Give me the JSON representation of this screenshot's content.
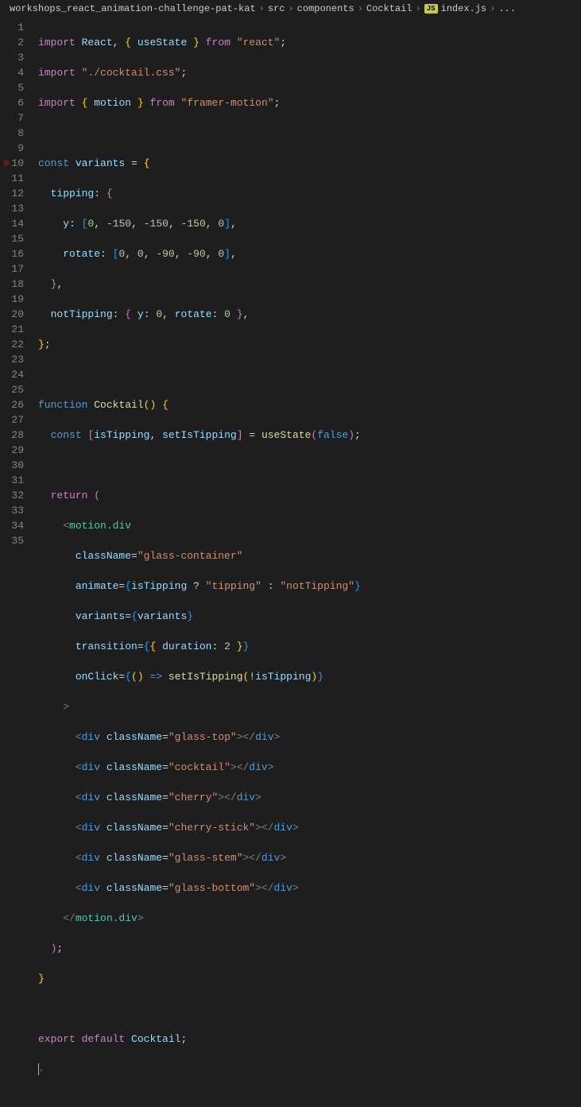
{
  "breadcrumb": {
    "items": [
      "workshops_react_animation-challenge-pat-kat",
      "src",
      "components",
      "Cocktail"
    ],
    "file": "index.js",
    "tail": "..."
  },
  "gutter": {
    "start": 1,
    "end": 35,
    "breakpoint": 10
  },
  "code": {
    "l1": {
      "t1": "import",
      "t2": "React",
      "t3": "useState",
      "t4": "from",
      "t5": "\"react\""
    },
    "l2": {
      "t1": "import",
      "t2": "\"./cocktail.css\""
    },
    "l3": {
      "t1": "import",
      "t2": "motion",
      "t3": "from",
      "t4": "\"framer-motion\""
    },
    "l5": {
      "t1": "const",
      "t2": "variants",
      "t3": "="
    },
    "l6": {
      "t1": "tipping",
      "t2": ":"
    },
    "l7": {
      "t1": "y",
      "t2": ":",
      "a": "0",
      "b": "-150",
      "c": "-150",
      "d": "-150",
      "e": "0"
    },
    "l8": {
      "t1": "rotate",
      "t2": ":",
      "a": "0",
      "b": "0",
      "c": "-90",
      "d": "-90",
      "e": "0"
    },
    "l10": {
      "t1": "notTipping",
      "t2": ":",
      "y": "y",
      "yv": "0",
      "r": "rotate",
      "rv": "0"
    },
    "l13": {
      "t1": "function",
      "t2": "Cocktail"
    },
    "l14": {
      "t1": "const",
      "a": "isTipping",
      "b": "setIsTipping",
      "c": "=",
      "d": "useState",
      "e": "false"
    },
    "l16": {
      "t1": "return"
    },
    "l17": {
      "t1": "motion.div"
    },
    "l18": {
      "a": "className",
      "b": "=",
      "c": "\"glass-container\""
    },
    "l19": {
      "a": "animate",
      "b": "=",
      "c": "isTipping",
      "d": "?",
      "e": "\"tipping\"",
      "f": ":",
      "g": "\"notTipping\""
    },
    "l20": {
      "a": "variants",
      "b": "=",
      "c": "variants"
    },
    "l21": {
      "a": "transition",
      "b": "=",
      "c": "duration",
      "d": ":",
      "e": "2"
    },
    "l22": {
      "a": "onClick",
      "b": "=",
      "c": "setIsTipping",
      "d": "isTipping"
    },
    "l24": {
      "a": "div",
      "b": "className",
      "c": "=",
      "d": "\"glass-top\"",
      "e": "div"
    },
    "l25": {
      "a": "div",
      "b": "className",
      "c": "=",
      "d": "\"cocktail\"",
      "e": "div"
    },
    "l26": {
      "a": "div",
      "b": "className",
      "c": "=",
      "d": "\"cherry\"",
      "e": "div"
    },
    "l27": {
      "a": "div",
      "b": "className",
      "c": "=",
      "d": "\"cherry-stick\"",
      "e": "div"
    },
    "l28": {
      "a": "div",
      "b": "className",
      "c": "=",
      "d": "\"glass-stem\"",
      "e": "div"
    },
    "l29": {
      "a": "div",
      "b": "className",
      "c": "=",
      "d": "\"glass-bottom\"",
      "e": "div"
    },
    "l30": {
      "a": "motion.div"
    },
    "l34": {
      "a": "export",
      "b": "default",
      "c": "Cocktail"
    }
  }
}
